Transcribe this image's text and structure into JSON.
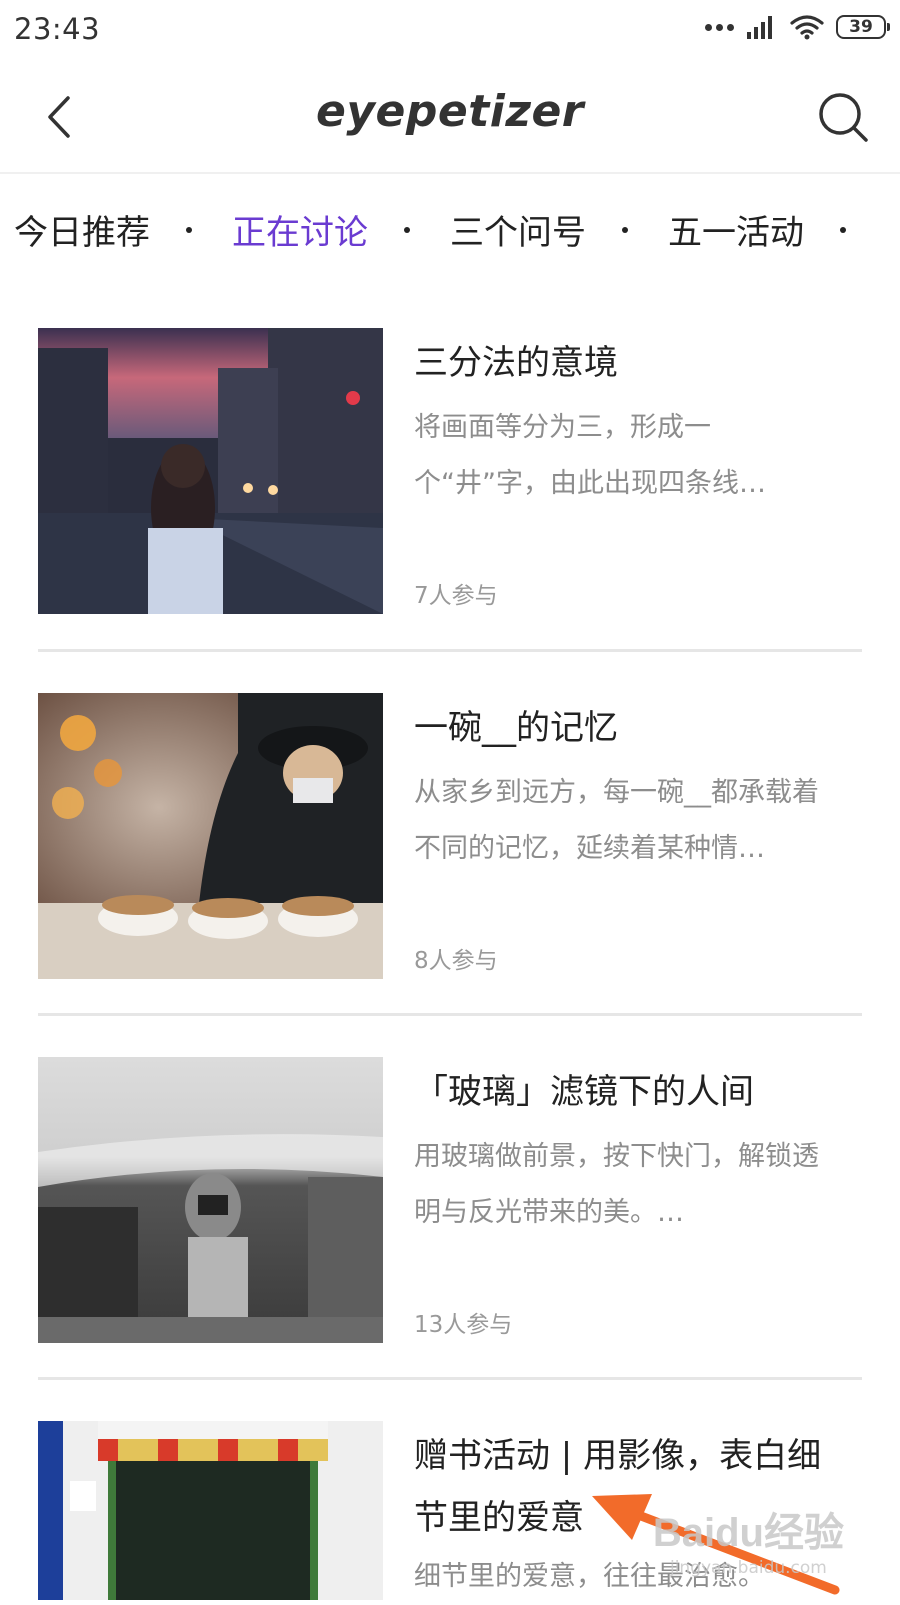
{
  "status_bar": {
    "time": "23:43",
    "battery": "39"
  },
  "header": {
    "logo": "eyepetizer",
    "back_icon": "chevron-left-icon",
    "search_icon": "search-icon"
  },
  "tabs": [
    {
      "label": "今日推荐",
      "active": false
    },
    {
      "label": "正在讨论",
      "active": true
    },
    {
      "label": "三个问号",
      "active": false
    },
    {
      "label": "五一活动",
      "active": false
    }
  ],
  "accent_color": "#6a3bd1",
  "topics": [
    {
      "title": "三分法的意境",
      "description": "将画面等分为三，形成一个“井”字，由此出现四条线…",
      "participants": "7人参与"
    },
    {
      "title": "一碗__的记忆",
      "description": "从家乡到远方，每一碗__都承载着不同的记忆，延续着某种情…",
      "participants": "8人参与"
    },
    {
      "title": "「玻璃」滤镜下的人间",
      "description": "用玻璃做前景，按下快门，解锁透明与反光带来的美。…",
      "participants": "13人参与"
    },
    {
      "title": "赠书活动 | 用影像，表白细节里的爱意",
      "description": "细节里的爱意，往往最治愈。",
      "participants": ""
    }
  ],
  "watermark": {
    "logo": "Baidu经验",
    "url": "jingyan.baidu.com"
  }
}
